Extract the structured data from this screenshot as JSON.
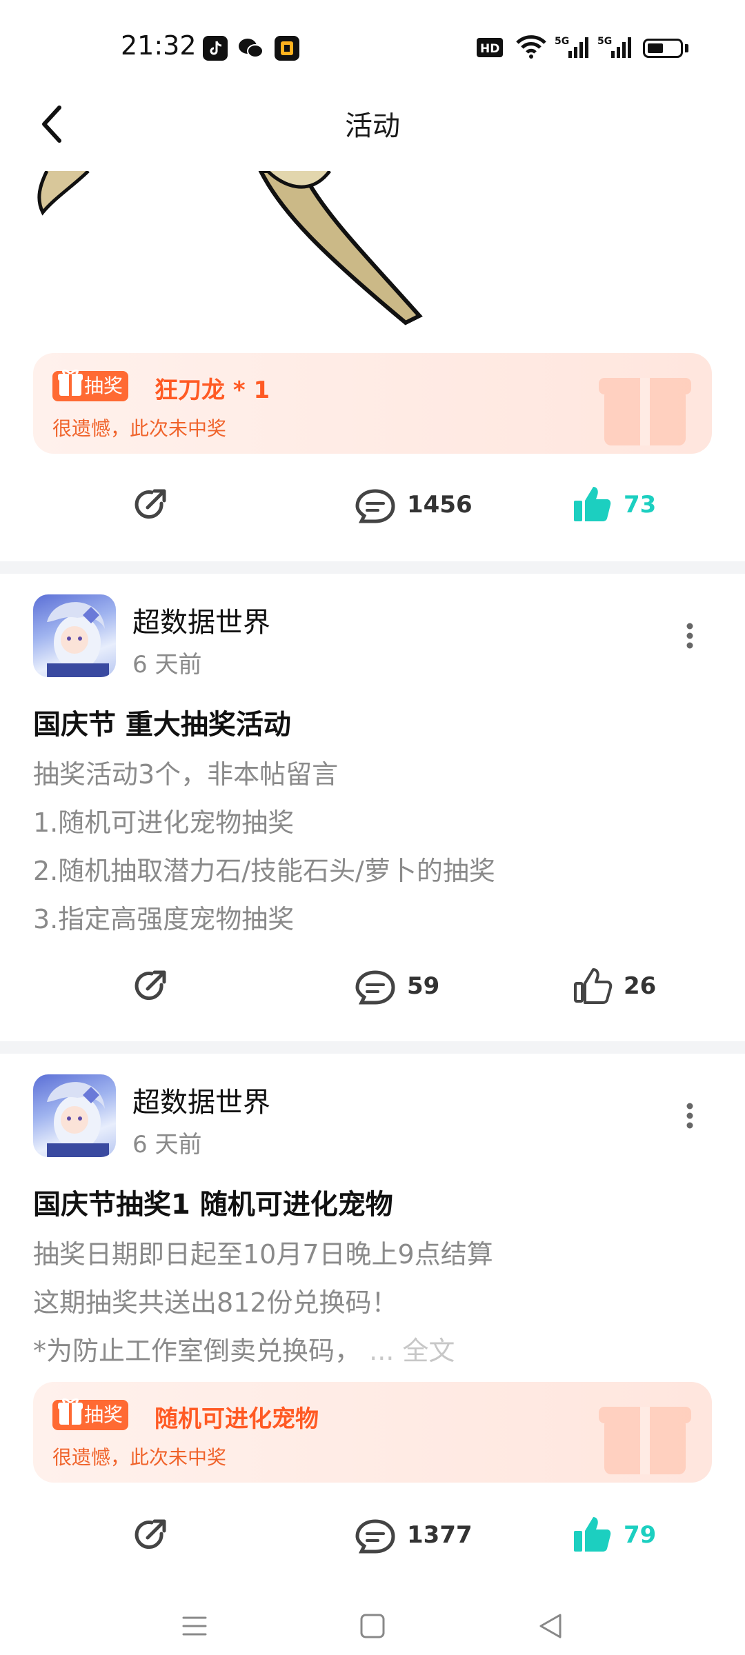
{
  "status_bar": {
    "time": "21:32",
    "icons": [
      "tiktok-icon",
      "wechat-icon",
      "app-icon",
      "hd-icon",
      "wifi-icon",
      "5g-signal-icon",
      "5g-signal-icon",
      "battery-icon"
    ],
    "right_label": "HD 5G 5G"
  },
  "header": {
    "title": "活动",
    "back_icon": "chevron-left-icon"
  },
  "post0": {
    "lottery": {
      "badge": "抽奖",
      "prize": "狂刀龙 * 1",
      "result": "很遗憾，此次未中奖"
    },
    "actions": {
      "comments": "1456",
      "likes": "73",
      "liked": true
    }
  },
  "post1": {
    "author": "超数据世界",
    "time_ago": "6 天前",
    "title": "国庆节 重大抽奖活动",
    "lines": [
      "抽奖活动3个，非本帖留言",
      "1.随机可进化宠物抽奖",
      "2.随机抽取潜力石/技能石头/萝卜的抽奖",
      "3.指定高强度宠物抽奖"
    ],
    "actions": {
      "comments": "59",
      "likes": "26",
      "liked": false
    }
  },
  "post2": {
    "author": "超数据世界",
    "time_ago": "6 天前",
    "title": "国庆节抽奖1 随机可进化宠物",
    "lines": [
      "抽奖日期即日起至10月7日晚上9点结算",
      "这期抽奖共送出812份兑换码！",
      "*为防止工作室倒卖兑换码，"
    ],
    "more_link": "... 全文",
    "lottery": {
      "badge": "抽奖",
      "prize": "随机可进化宠物",
      "result": "很遗憾，此次未中奖"
    },
    "actions": {
      "comments": "1377",
      "likes": "79",
      "liked": true
    }
  },
  "colors": {
    "accent_orange": "#ff6a33",
    "liked_teal": "#1ccfc0",
    "muted_text": "#8a8a8a"
  }
}
